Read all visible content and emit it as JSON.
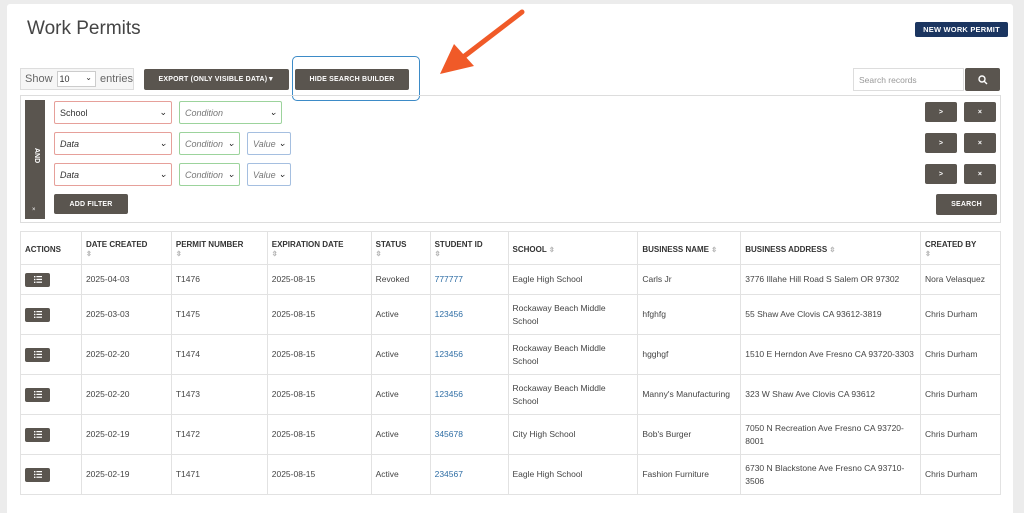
{
  "page": {
    "title": "Work Permits",
    "new_button": "NEW WORK PERMIT"
  },
  "toolbar": {
    "show_label": "Show",
    "show_value": "10",
    "entries_label": "entries",
    "export_label": "EXPORT (ONLY VISIBLE DATA)▼",
    "hide_search_label": "HIDE SEARCH BUILDER",
    "search_placeholder": "Search records"
  },
  "builder": {
    "logic_label": "AND",
    "logic_remove": "×",
    "rows": [
      {
        "field": "School",
        "condition": "Condition",
        "value": null
      },
      {
        "field": "Data",
        "condition": "Condition",
        "value": "Value"
      },
      {
        "field": "Data",
        "condition": "Condition",
        "value": "Value"
      }
    ],
    "indent_btn": ">",
    "remove_btn": "×",
    "add_filter": "ADD FILTER",
    "search_button": "SEARCH"
  },
  "table": {
    "columns": [
      "ACTIONS",
      "DATE CREATED",
      "PERMIT NUMBER",
      "EXPIRATION DATE",
      "STATUS",
      "STUDENT ID",
      "SCHOOL",
      "BUSINESS NAME",
      "BUSINESS ADDRESS",
      "CREATED BY"
    ],
    "rows": [
      [
        "",
        "2025-04-03",
        "T1476",
        "2025-08-15",
        "Revoked",
        "777777",
        "Eagle High School",
        "Carls Jr",
        "3776 Illahe Hill Road S Salem OR 97302",
        "Nora Velasquez"
      ],
      [
        "",
        "2025-03-03",
        "T1475",
        "2025-08-15",
        "Active",
        "123456",
        "Rockaway Beach Middle School",
        "hfghfg",
        "55 Shaw Ave Clovis CA 93612-3819",
        "Chris Durham"
      ],
      [
        "",
        "2025-02-20",
        "T1474",
        "2025-08-15",
        "Active",
        "123456",
        "Rockaway Beach Middle School",
        "hgghgf",
        "1510 E Herndon Ave Fresno CA 93720-3303",
        "Chris Durham"
      ],
      [
        "",
        "2025-02-20",
        "T1473",
        "2025-08-15",
        "Active",
        "123456",
        "Rockaway Beach Middle School",
        "Manny's Manufacturing",
        "323 W Shaw Ave Clovis CA 93612",
        "Chris Durham"
      ],
      [
        "",
        "2025-02-19",
        "T1472",
        "2025-08-15",
        "Active",
        "345678",
        "City High School",
        "Bob's Burger",
        "7050 N Recreation Ave Fresno CA 93720-8001",
        "Chris Durham"
      ],
      [
        "",
        "2025-02-19",
        "T1471",
        "2025-08-15",
        "Active",
        "234567",
        "Eagle High School",
        "Fashion Furniture",
        "6730 N Blackstone Ave Fresno CA 93710-3506",
        "Chris Durham"
      ]
    ]
  },
  "colors": {
    "primary_button": "#1b3560",
    "dark_button": "#5a554f",
    "highlight": "#3d8bc7",
    "arrow": "#f05a28",
    "link": "#2e6da4"
  }
}
